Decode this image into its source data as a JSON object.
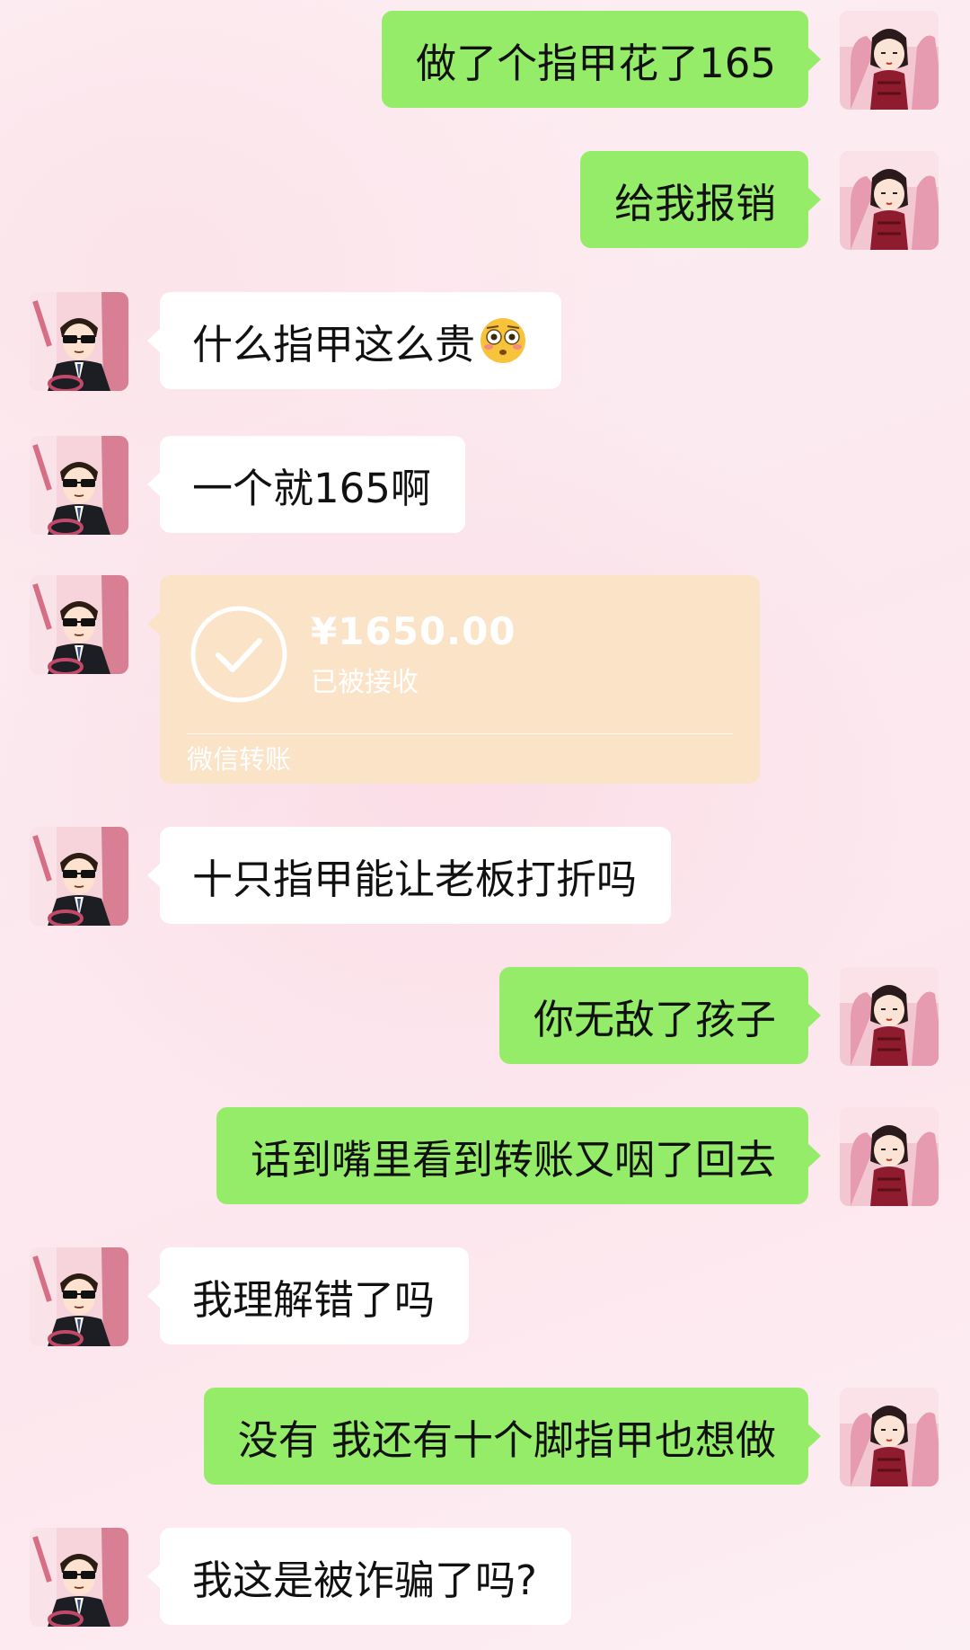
{
  "chat": {
    "m1": "做了个指甲花了165",
    "m2": "给我报销",
    "m3": "什么指甲这么贵",
    "m3_emoji": "flushed-face-emoji",
    "m4": "一个就165啊",
    "transfer": {
      "amount": "¥1650.00",
      "status": "已被接收",
      "footer": "微信转账",
      "color": "#fbe3c8"
    },
    "m6": "十只指甲能让老板打折吗",
    "m7": "你无敌了孩子",
    "m8": "话到嘴里看到转账又咽了回去",
    "m9": "我理解错了吗",
    "m10": "没有 我还有十个脚指甲也想做",
    "m11": "我这是被诈骗了吗?"
  },
  "colors": {
    "sent_bubble": "#95ec69",
    "received_bubble": "#ffffff",
    "background": "#fceff3"
  },
  "avatars": {
    "me": "cartoon-girl-avatar",
    "boss": "cartoon-man-sunglasses-avatar"
  }
}
